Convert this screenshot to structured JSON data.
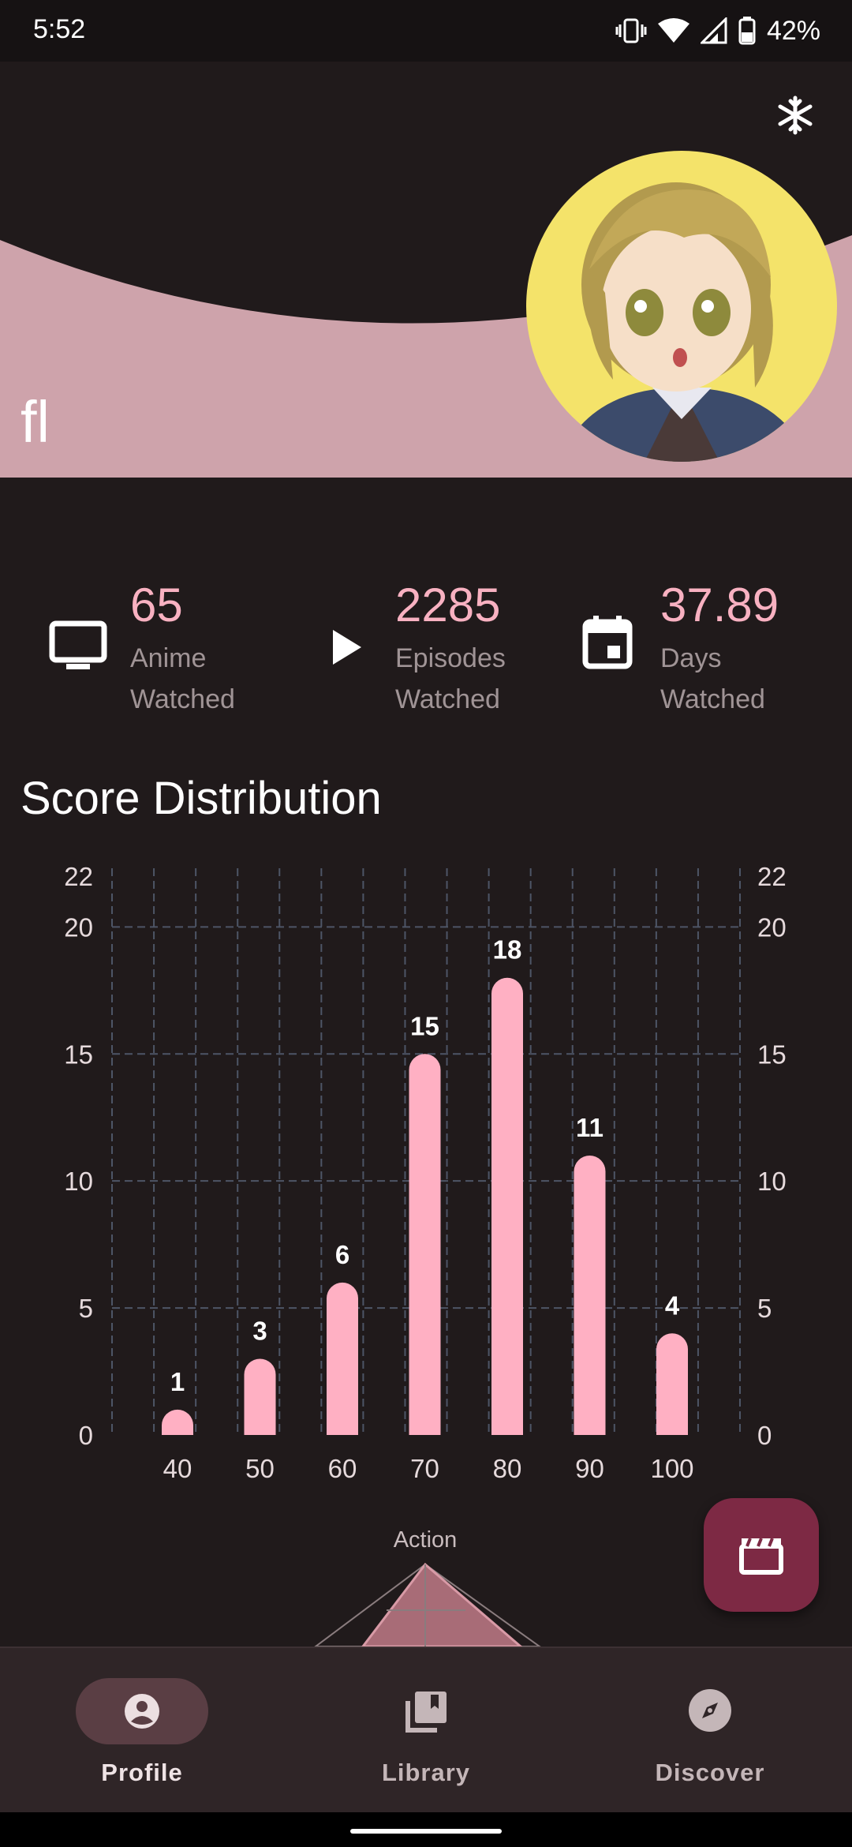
{
  "status_bar": {
    "time": "5:52",
    "battery": "42%"
  },
  "profile": {
    "username": "fl"
  },
  "stats": [
    {
      "icon": "tv-icon",
      "value": "65",
      "label_line1": "Anime",
      "label_line2": "Watched"
    },
    {
      "icon": "play-icon",
      "value": "2285",
      "label_line1": "Episodes",
      "label_line2": "Watched"
    },
    {
      "icon": "calendar-icon",
      "value": "37.89",
      "label_line1": "Days",
      "label_line2": "Watched"
    }
  ],
  "section_title": "Score Distribution",
  "chart_data": {
    "type": "bar",
    "categories": [
      "40",
      "50",
      "60",
      "70",
      "80",
      "90",
      "100"
    ],
    "values": [
      1,
      3,
      6,
      15,
      18,
      11,
      4
    ],
    "title": "Score Distribution",
    "xlabel": "",
    "ylabel": "",
    "ylim": [
      0,
      22
    ],
    "y_ticks": [
      "0",
      "5",
      "10",
      "15",
      "20",
      "22"
    ],
    "grid": true,
    "bar_color": "#ffb0c3"
  },
  "radar": {
    "top_label": "Action"
  },
  "nav": [
    {
      "label": "Profile",
      "icon": "profile-icon",
      "active": true
    },
    {
      "label": "Library",
      "icon": "library-icon",
      "active": false
    },
    {
      "label": "Discover",
      "icon": "compass-icon",
      "active": false
    }
  ],
  "colors": {
    "accent": "#f8b1c1",
    "header_pink": "#cea3ab",
    "fab": "#7d2944",
    "background": "#201a1b"
  }
}
